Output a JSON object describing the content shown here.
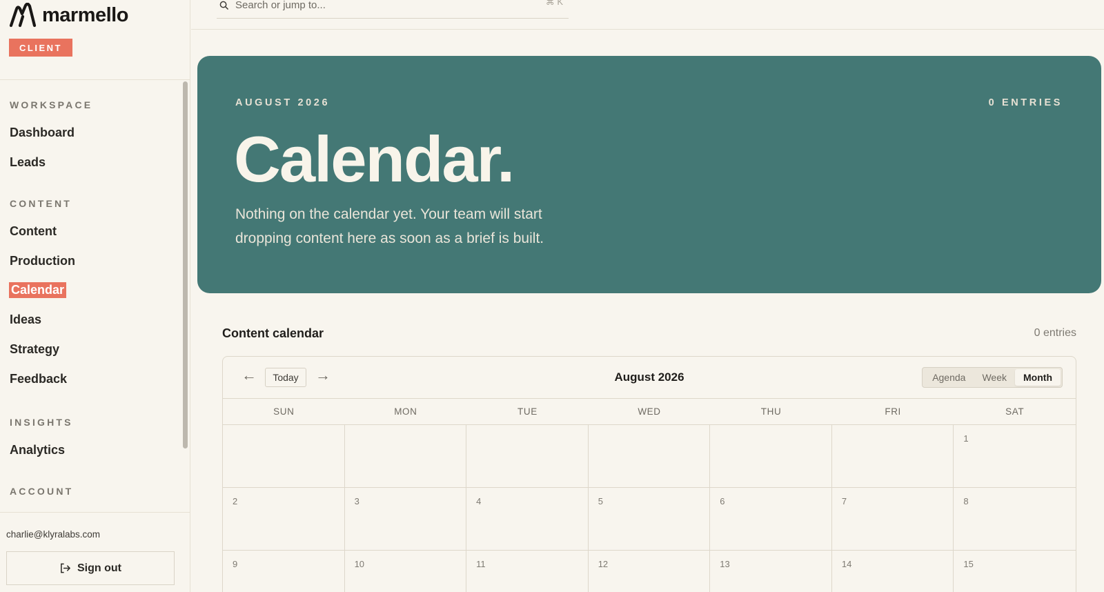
{
  "brand": {
    "name": "marmello",
    "badge": "CLIENT"
  },
  "search": {
    "placeholder": "Search or jump to...",
    "shortcut": "⌘ K"
  },
  "sidebar": {
    "sections": [
      {
        "label": "WORKSPACE",
        "items": [
          "Dashboard",
          "Leads"
        ]
      },
      {
        "label": "CONTENT",
        "items": [
          "Content",
          "Production",
          "Calendar",
          "Ideas",
          "Strategy",
          "Feedback"
        ]
      },
      {
        "label": "INSIGHTS",
        "items": [
          "Analytics"
        ]
      },
      {
        "label": "ACCOUNT",
        "items": []
      }
    ],
    "active_item": "Calendar",
    "user_email": "charlie@klyralabs.com",
    "signout_label": "Sign out"
  },
  "hero": {
    "eyebrow": "AUGUST 2026",
    "entries_count": "0 ENTRIES",
    "title": "Calendar.",
    "description": "Nothing on the calendar yet. Your team will start dropping content here as soon as a brief is built."
  },
  "calendar": {
    "heading": "Content calendar",
    "entries": "0 entries",
    "prev_arrow": "←",
    "next_arrow": "→",
    "today_label": "Today",
    "month_label": "August 2026",
    "views": [
      "Agenda",
      "Week",
      "Month"
    ],
    "active_view": "Month",
    "weekdays": [
      "SUN",
      "MON",
      "TUE",
      "WED",
      "THU",
      "FRI",
      "SAT"
    ],
    "days": [
      "",
      "",
      "",
      "",
      "",
      "",
      "1",
      "2",
      "3",
      "4",
      "5",
      "6",
      "7",
      "8",
      "9",
      "10",
      "11",
      "12",
      "13",
      "14",
      "15"
    ]
  },
  "colors": {
    "accent": "#e9735e",
    "hero_bg": "#447875",
    "page_bg": "#f8f5ee"
  }
}
